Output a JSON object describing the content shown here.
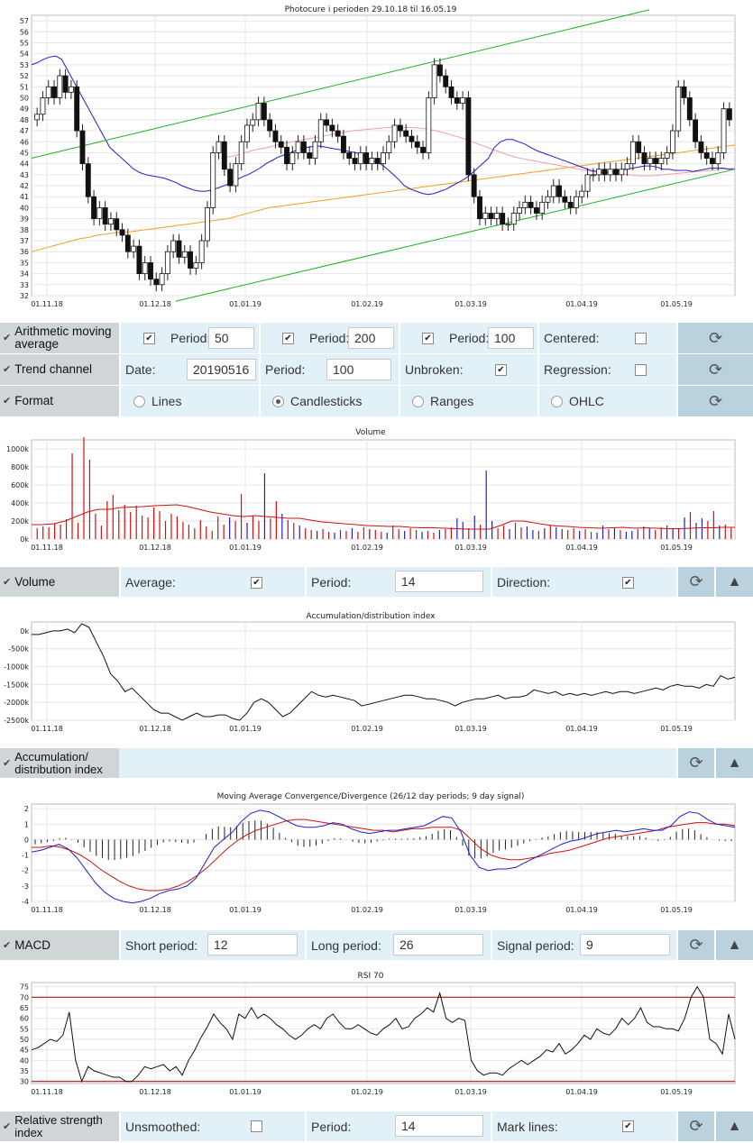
{
  "x_tick_labels": [
    "01.11.18",
    "01.12.18",
    "01.01.19",
    "01.02.19",
    "01.03.19",
    "01.04.19",
    "01.05.19"
  ],
  "price": {
    "title": "Photocure i perioden 29.10.18 til 16.05.19",
    "y_ticks": [
      32,
      33,
      34,
      35,
      36,
      37,
      38,
      39,
      40,
      41,
      42,
      43,
      44,
      45,
      46,
      47,
      48,
      49,
      50,
      51,
      52,
      53,
      54,
      55,
      56,
      57
    ]
  },
  "volume": {
    "title": "Volume",
    "y_ticks": [
      "0k",
      "200k",
      "400k",
      "600k",
      "800k",
      "1000k"
    ]
  },
  "ad": {
    "title": "Accumulation/distribution index",
    "y_ticks": [
      "0k",
      "-500k",
      "-1000k",
      "-1500k",
      "-2000k",
      "-2500k"
    ]
  },
  "macd": {
    "title": "Moving Average Convergence/Divergence (26/12 day periods; 9 day signal)",
    "y_ticks": [
      "2",
      "1",
      "0",
      "-1",
      "-2",
      "-3",
      "-4"
    ]
  },
  "rsi": {
    "title": "RSI 70",
    "y_ticks": [
      "75",
      "70",
      "65",
      "60",
      "55",
      "50",
      "45",
      "40",
      "35",
      "30"
    ]
  },
  "controls": {
    "ma": {
      "label": "Arithmetic moving average",
      "period_label": "Period:",
      "p1": "50",
      "p2": "200",
      "p3": "100",
      "centered_label": "Centered:"
    },
    "trend": {
      "label": "Trend channel",
      "date_label": "Date:",
      "date": "20190516",
      "period_label": "Period:",
      "period": "100",
      "unbroken_label": "Unbroken:",
      "regression_label": "Regression:"
    },
    "format": {
      "label": "Format",
      "lines": "Lines",
      "candles": "Candlesticks",
      "ranges": "Ranges",
      "ohlc": "OHLC",
      "selected": "Candlesticks"
    },
    "volume": {
      "label": "Volume",
      "average_label": "Average:",
      "period_label": "Period:",
      "period": "14",
      "direction_label": "Direction:"
    },
    "ad": {
      "label": "Accumulation/ distribution index"
    },
    "macd": {
      "label": "MACD",
      "short_label": "Short period:",
      "short": "12",
      "long_label": "Long period:",
      "long": "26",
      "signal_label": "Signal period:",
      "signal": "9"
    },
    "rsi": {
      "label": "Relative strength index",
      "unsmoothed_label": "Unsmoothed:",
      "period_label": "Period:",
      "period": "14",
      "marklines_label": "Mark lines:"
    }
  },
  "colors": {
    "ma50": "#2020c8",
    "ma200": "#f0a020",
    "ma100": "#f0a0a8",
    "trend": "#20b020",
    "up": "#2020c8",
    "down": "#d01010",
    "mark": "#c01010"
  },
  "chart_data": [
    {
      "type": "candlestick",
      "title": "Photocure i perioden 29.10.18 til 16.05.19",
      "ylim": [
        32,
        57.5
      ],
      "x_range": [
        "2018-10-29",
        "2019-05-16"
      ],
      "candles_close": [
        48.5,
        50,
        51,
        50,
        52,
        50.5,
        51,
        47,
        44,
        41,
        39,
        40,
        38.5,
        39,
        38,
        37.5,
        36,
        36.5,
        34,
        35,
        33.5,
        33,
        34,
        36,
        37,
        35.5,
        36,
        34.5,
        35,
        37,
        40,
        45,
        46,
        43.5,
        42,
        44,
        46,
        47.5,
        48,
        49.5,
        48,
        47,
        46,
        45.5,
        44,
        45,
        46,
        45,
        44.5,
        46,
        48,
        47.5,
        47,
        46.5,
        45,
        44.5,
        44,
        45,
        44,
        44.5,
        44,
        45,
        46,
        47.5,
        47,
        46.5,
        46,
        45.5,
        45,
        50,
        53,
        52,
        51,
        50,
        49.5,
        50,
        43,
        41,
        39,
        39.5,
        39,
        39.5,
        38.5,
        38.5,
        39.5,
        40,
        40.5,
        40,
        39.5,
        40.5,
        41,
        42,
        41,
        40.5,
        40,
        41,
        41.5,
        43,
        43,
        43.5,
        43,
        43.5,
        43,
        43.5,
        44,
        46,
        45,
        44,
        44.5,
        44,
        44.5,
        45,
        47,
        51,
        50,
        48,
        46,
        45,
        44.5,
        44,
        45,
        49,
        48
      ],
      "series": [
        {
          "name": "50",
          "values": [
            53,
            53.2,
            53.5,
            53.7,
            53.8,
            53.5,
            52.5,
            51.5,
            50.5,
            49.5,
            48.5,
            47.5,
            46.5,
            45.5,
            45,
            44.5,
            44,
            43.5,
            43.2,
            43,
            42.9,
            42.8,
            42.7,
            42.5,
            42.3,
            42,
            41.8,
            41.6,
            41.5,
            41.5,
            41.6,
            41.8,
            42,
            42.2,
            42.5,
            42.8,
            43,
            43.3,
            43.6,
            44,
            44.3,
            44.6,
            44.8,
            45,
            45.2,
            45.4,
            45.5,
            45.6,
            45.6,
            45.5,
            45.4,
            45.3,
            45.2,
            45.1,
            45,
            44.8,
            44.5,
            44.2,
            44,
            43.6,
            43.1,
            42.6,
            42,
            41.7,
            41.5,
            41.3,
            41.2,
            41.3,
            41.5,
            41.7,
            42,
            42.3,
            42.6,
            43,
            43.5,
            44,
            44.5,
            45.5,
            46,
            46.2,
            46.2,
            46,
            45.8,
            45.5,
            45.2,
            45,
            44.8,
            44.6,
            44.4,
            44.2,
            44,
            43.8,
            43.6,
            43.4,
            43.3,
            43.2,
            43.2,
            43.3,
            43.4,
            43.5,
            43.6,
            43.7,
            43.8,
            43.8,
            43.7,
            43.5,
            43.5,
            43.4,
            43.4,
            43.4,
            43.3,
            43.4,
            43.5,
            43.6,
            43.6,
            43.6,
            43.5,
            43.5
          ]
        },
        {
          "name": "200",
          "values": [
            36,
            36.2,
            36.4,
            36.6,
            36.8,
            37,
            37.2,
            37.3,
            37.5,
            37.6,
            37.7,
            37.8,
            37.8,
            37.9,
            38,
            38.1,
            38.2,
            38.3,
            38.4,
            38.5,
            38.6,
            38.7,
            38.8,
            38.9,
            39,
            39.2,
            39.4,
            39.6,
            39.8,
            40,
            40.1,
            40.2,
            40.3,
            40.4,
            40.5,
            40.6,
            40.7,
            40.8,
            40.9,
            41,
            41.1,
            41.2,
            41.3,
            41.4,
            41.5,
            41.6,
            41.7,
            41.8,
            41.9,
            42,
            42.1,
            42.2,
            42.3,
            42.4,
            42.5,
            42.6,
            42.7,
            42.8,
            42.9,
            43,
            43.1,
            43.2,
            43.3,
            43.4,
            43.5,
            43.6,
            43.7,
            43.8,
            43.9,
            44,
            44.1,
            44.2,
            44.3,
            44.4,
            44.5,
            44.6,
            44.7,
            44.8,
            44.9,
            45,
            45.1,
            45.2,
            45.3,
            45.4,
            45.5,
            45.6,
            45.7
          ]
        },
        {
          "name": "100",
          "values": [
            44.5,
            44.7,
            45,
            45.3,
            45.5,
            45.8,
            46,
            46.2,
            46.4,
            46.6,
            46.8,
            47,
            47.1,
            47.2,
            47.3,
            47.3,
            47.3,
            47.2,
            47,
            46.7,
            46.4,
            46,
            45.6,
            45.2,
            44.8,
            44.5,
            44.3,
            44.1,
            43.9,
            43.7,
            43.5,
            43.3,
            43.2,
            43.1,
            43,
            42.9,
            42.9,
            43,
            43.1,
            43.2,
            43.3,
            43.4,
            43.5,
            43.6
          ]
        },
        {
          "name": "trend_upper",
          "values": [
            44.5,
            58
          ]
        },
        {
          "name": "trend_lower",
          "values": [
            31.5,
            43.5
          ]
        }
      ]
    },
    {
      "type": "bar",
      "title": "Volume",
      "ylim": [
        0,
        1100
      ],
      "values": [
        120,
        140,
        130,
        170,
        160,
        220,
        950,
        180,
        1130,
        880,
        280,
        150,
        420,
        490,
        320,
        380,
        300,
        370,
        260,
        240,
        350,
        310,
        200,
        280,
        250,
        190,
        160,
        120,
        210,
        140,
        90,
        250,
        160,
        240,
        200,
        500,
        180,
        260,
        200,
        730,
        230,
        420,
        280,
        210,
        180,
        150,
        120,
        100,
        90,
        110,
        80,
        70,
        100,
        90,
        120,
        80,
        130,
        110,
        100,
        80,
        70,
        150,
        110,
        90,
        120,
        100,
        80,
        90,
        70,
        100,
        110,
        130,
        230,
        190,
        120,
        260,
        160,
        760,
        200,
        120,
        150,
        110,
        180,
        130,
        140,
        100,
        90,
        120,
        150,
        130,
        110,
        100,
        120,
        90,
        110,
        80,
        70,
        150,
        110,
        120,
        100,
        80,
        90,
        110,
        140,
        120,
        100,
        130,
        150,
        110,
        120,
        240,
        300,
        180,
        230,
        200,
        310,
        150,
        160,
        130
      ],
      "series": [
        {
          "name": "average",
          "values": [
            160,
            160,
            170,
            200,
            250,
            300,
            330,
            330,
            350,
            355,
            360,
            370,
            375,
            380,
            360,
            330,
            300,
            280,
            260,
            250,
            260,
            250,
            240,
            230,
            230,
            210,
            190,
            180,
            170,
            160,
            150,
            145,
            140,
            140,
            130,
            125,
            125,
            120,
            115,
            110,
            110,
            110,
            150,
            200,
            200,
            180,
            160,
            145,
            140,
            130,
            125,
            120,
            125,
            130,
            120,
            125,
            120,
            115,
            115,
            120,
            125,
            125,
            130,
            130
          ]
        }
      ]
    },
    {
      "type": "line",
      "title": "Accumulation/distribution index",
      "ylim": [
        -2500,
        250
      ],
      "values": [
        -100,
        -100,
        -50,
        0,
        0,
        50,
        -50,
        200,
        100,
        -300,
        -700,
        -1200,
        -1400,
        -1700,
        -1600,
        -1800,
        -2000,
        -2200,
        -2300,
        -2300,
        -2400,
        -2500,
        -2400,
        -2300,
        -2400,
        -2400,
        -2350,
        -2350,
        -2450,
        -2500,
        -2300,
        -2000,
        -1900,
        -2000,
        -2200,
        -2400,
        -2300,
        -2100,
        -1900,
        -1700,
        -1800,
        -1850,
        -1800,
        -1850,
        -1900,
        -1950,
        -2100,
        -2050,
        -2000,
        -1950,
        -1900,
        -1850,
        -1800,
        -1800,
        -1850,
        -1900,
        -1900,
        -1950,
        -2000,
        -2100,
        -2000,
        -1950,
        -1900,
        -1900,
        -1850,
        -1800,
        -1900,
        -1850,
        -1850,
        -1800,
        -1650,
        -1700,
        -1750,
        -1700,
        -1800,
        -1750,
        -1800,
        -1750,
        -1800,
        -1750,
        -1700,
        -1750,
        -1700,
        -1700,
        -1750,
        -1700,
        -1650,
        -1600,
        -1650,
        -1550,
        -1500,
        -1550,
        -1550,
        -1600,
        -1500,
        -1550,
        -1250,
        -1350,
        -1300
      ]
    },
    {
      "type": "line",
      "title": "Moving Average Convergence/Divergence (26/12 day periods; 9 day signal)",
      "ylim": [
        -4,
        2.3
      ],
      "series": [
        {
          "name": "macd",
          "values": [
            -0.8,
            -0.7,
            -0.5,
            -0.3,
            -0.6,
            -1.2,
            -2,
            -2.8,
            -3.4,
            -3.8,
            -4,
            -4.1,
            -4,
            -3.8,
            -3.5,
            -3.3,
            -3.2,
            -3,
            -2.5,
            -1.5,
            -0.5,
            0,
            0.5,
            1.2,
            1.7,
            1.9,
            1.8,
            1.5,
            1.2,
            0.9,
            0.8,
            0.8,
            0.9,
            1.1,
            1,
            0.7,
            0.5,
            0.4,
            0.5,
            0.6,
            0.6,
            0.7,
            0.8,
            0.9,
            1.2,
            1.5,
            1.4,
            0.5,
            -1,
            -1.8,
            -2,
            -1.9,
            -1.9,
            -1.8,
            -1.5,
            -1.2,
            -0.9,
            -0.6,
            -0.3,
            -0.1,
            0,
            0.2,
            0.4,
            0.5,
            0.6,
            0.5,
            0.6,
            0.7,
            0.6,
            0.6,
            0.9,
            1.5,
            1.8,
            1.7,
            1.3,
            1,
            0.9,
            0.8
          ]
        },
        {
          "name": "signal",
          "values": [
            -0.5,
            -0.5,
            -0.4,
            -0.5,
            -0.7,
            -1,
            -1.4,
            -1.9,
            -2.3,
            -2.7,
            -3,
            -3.2,
            -3.3,
            -3.3,
            -3.2,
            -3,
            -2.7,
            -2.3,
            -1.8,
            -1.2,
            -0.6,
            -0.1,
            0.3,
            0.6,
            0.8,
            1,
            1.2,
            1.3,
            1.3,
            1.2,
            1.1,
            1,
            0.9,
            0.8,
            0.7,
            0.6,
            0.6,
            0.5,
            0.6,
            0.7,
            0.7,
            0.8,
            0.8,
            0.8,
            0.6,
            0,
            -0.6,
            -1,
            -1.2,
            -1.3,
            -1.3,
            -1.2,
            -1.1,
            -0.9,
            -0.8,
            -0.7,
            -0.5,
            -0.3,
            -0.1,
            0.1,
            0.2,
            0.3,
            0.4,
            0.5,
            0.6,
            0.8,
            0.9,
            1,
            1.1,
            1.1,
            1,
            1,
            0.9
          ]
        }
      ]
    },
    {
      "type": "line",
      "title": "RSI 70",
      "ylim": [
        29,
        77
      ],
      "values": [
        45,
        46,
        48,
        50,
        49,
        52,
        63,
        40,
        30,
        37,
        35,
        34,
        33,
        32,
        32,
        30,
        30,
        33,
        37,
        36,
        37,
        38,
        35,
        37,
        33,
        40,
        45,
        51,
        56,
        62,
        58,
        55,
        50,
        62,
        60,
        65,
        60,
        62,
        60,
        57,
        55,
        52,
        50,
        52,
        55,
        57,
        55,
        60,
        62,
        58,
        55,
        55,
        57,
        55,
        53,
        52,
        55,
        57,
        60,
        55,
        56,
        60,
        62,
        65,
        63,
        72,
        60,
        58,
        60,
        59,
        40,
        35,
        33,
        34,
        34,
        33,
        36,
        38,
        40,
        38,
        40,
        42,
        45,
        44,
        48,
        43,
        45,
        48,
        52,
        50,
        55,
        53,
        52,
        55,
        60,
        57,
        60,
        65,
        58,
        56,
        56,
        55,
        55,
        54,
        60,
        70,
        75,
        70,
        50,
        48,
        43,
        62,
        50
      ]
    }
  ]
}
